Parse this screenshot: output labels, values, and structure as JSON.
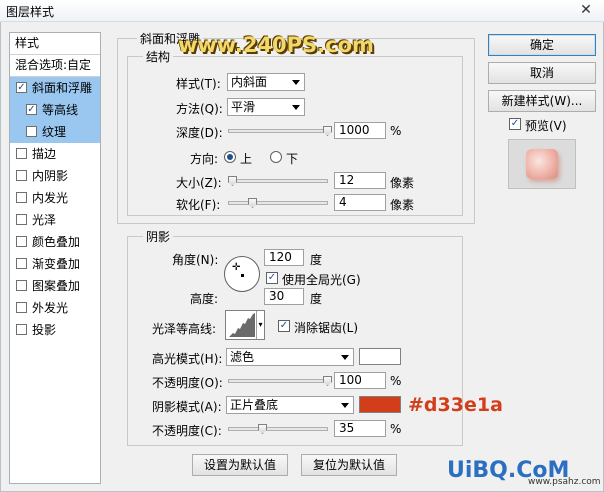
{
  "window": {
    "title": "图层样式"
  },
  "style_list": {
    "header": "样式",
    "blend": "混合选项:自定",
    "items": [
      {
        "label": "斜面和浮雕",
        "checked": true,
        "selected": true,
        "sub": false
      },
      {
        "label": "等高线",
        "checked": true,
        "selected": true,
        "sub": true
      },
      {
        "label": "纹理",
        "checked": false,
        "selected": true,
        "sub": true
      },
      {
        "label": "描边",
        "checked": false,
        "selected": false,
        "sub": false
      },
      {
        "label": "内阴影",
        "checked": false,
        "selected": false,
        "sub": false
      },
      {
        "label": "内发光",
        "checked": false,
        "selected": false,
        "sub": false
      },
      {
        "label": "光泽",
        "checked": false,
        "selected": false,
        "sub": false
      },
      {
        "label": "颜色叠加",
        "checked": false,
        "selected": false,
        "sub": false
      },
      {
        "label": "渐变叠加",
        "checked": false,
        "selected": false,
        "sub": false
      },
      {
        "label": "图案叠加",
        "checked": false,
        "selected": false,
        "sub": false
      },
      {
        "label": "外发光",
        "checked": false,
        "selected": false,
        "sub": false
      },
      {
        "label": "投影",
        "checked": false,
        "selected": false,
        "sub": false
      }
    ]
  },
  "bevel": {
    "group_title": "斜面和浮雕",
    "structure_title": "结构",
    "style_label": "样式(T):",
    "style_value": "内斜面",
    "technique_label": "方法(Q):",
    "technique_value": "平滑",
    "depth_label": "深度(D):",
    "depth_value": "1000",
    "depth_unit": "%",
    "depth_fraction": 1.0,
    "direction_label": "方向:",
    "dir_up": "上",
    "dir_down": "下",
    "size_label": "大小(Z):",
    "size_value": "12",
    "size_unit": "像素",
    "size_fraction": 0.05,
    "soften_label": "软化(F):",
    "soften_value": "4",
    "soften_unit": "像素",
    "soften_fraction": 0.25
  },
  "shading": {
    "title": "阴影",
    "angle_label": "角度(N):",
    "angle_value": "120",
    "angle_unit": "度",
    "global_light_label": "使用全局光(G)",
    "altitude_label": "高度:",
    "altitude_value": "30",
    "altitude_unit": "度",
    "gloss_label": "光泽等高线:",
    "antialias_label": "消除锯齿(L)",
    "highlight_label": "高光模式(H):",
    "highlight_mode": "滤色",
    "highlight_color": "#ffffff",
    "hl_opacity_label": "不透明度(O):",
    "hl_opacity_value": "100",
    "hl_opacity_unit": "%",
    "hl_opacity_fraction": 1.0,
    "shadow_label": "阴影模式(A):",
    "shadow_mode": "正片叠底",
    "shadow_color": "#d33e1a",
    "sh_opacity_label": "不透明度(C):",
    "sh_opacity_value": "35",
    "sh_opacity_unit": "%",
    "sh_opacity_fraction": 0.35
  },
  "buttons": {
    "make_default": "设置为默认值",
    "reset_default": "复位为默认值",
    "ok": "确定",
    "cancel": "取消",
    "new_style": "新建样式(W)...",
    "preview": "预览(V)"
  },
  "annotations": {
    "color_code": "#d33e1a",
    "watermark_top": "www.240PS.com",
    "watermark_bottom": "UiBQ.CoM",
    "watermark_small": "www.psahz.com"
  }
}
